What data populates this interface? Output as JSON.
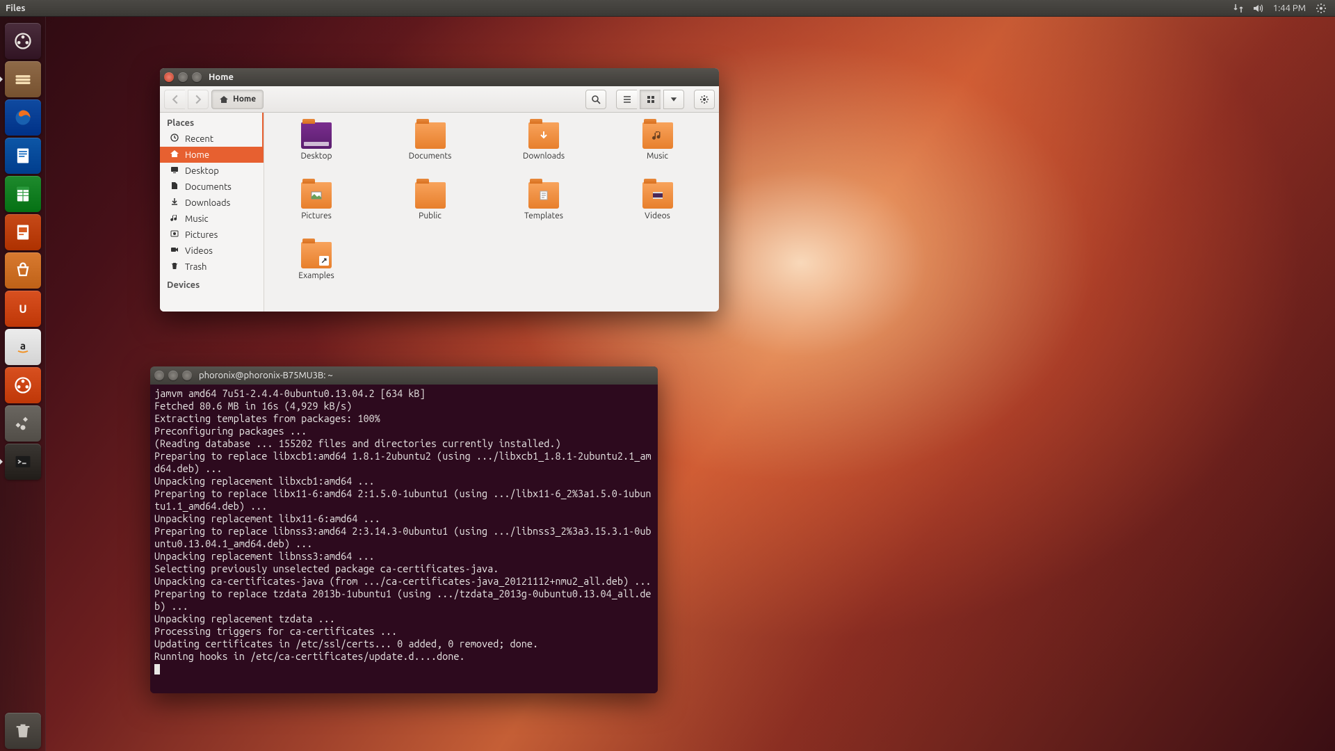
{
  "panel": {
    "app_title": "Files",
    "clock": "1:44 PM"
  },
  "launcher": {
    "items": [
      {
        "id": "dash",
        "name": "dash-icon",
        "color": "#4a2d3c"
      },
      {
        "id": "files",
        "name": "files-icon",
        "color": "#8f6a48",
        "running": true
      },
      {
        "id": "firefox",
        "name": "firefox-icon",
        "color": "#0f4aa0"
      },
      {
        "id": "writer",
        "name": "libreoffice-writer-icon",
        "color": "#0d56a6"
      },
      {
        "id": "calc",
        "name": "libreoffice-calc-icon",
        "color": "#1e8a2d"
      },
      {
        "id": "impress",
        "name": "libreoffice-impress-icon",
        "color": "#c74a19"
      },
      {
        "id": "software",
        "name": "software-center-icon",
        "color": "#d87a30"
      },
      {
        "id": "ubuntu-one",
        "name": "ubuntu-one-icon",
        "color": "#d85020"
      },
      {
        "id": "amazon",
        "name": "amazon-icon",
        "color": "#ececec"
      },
      {
        "id": "updater",
        "name": "software-updater-icon",
        "color": "#d85020"
      },
      {
        "id": "settings",
        "name": "system-settings-icon",
        "color": "#6a6660"
      },
      {
        "id": "terminal",
        "name": "terminal-icon",
        "color": "#3a3632",
        "running": true
      }
    ],
    "trash_name": "trash-icon"
  },
  "files_window": {
    "title": "Home",
    "path_label": "Home",
    "sidebar": {
      "places_label": "Places",
      "items": [
        {
          "label": "Recent",
          "icon": "clock"
        },
        {
          "label": "Home",
          "icon": "home",
          "active": true
        },
        {
          "label": "Desktop",
          "icon": "desktop"
        },
        {
          "label": "Documents",
          "icon": "documents"
        },
        {
          "label": "Downloads",
          "icon": "downloads"
        },
        {
          "label": "Music",
          "icon": "music"
        },
        {
          "label": "Pictures",
          "icon": "pictures"
        },
        {
          "label": "Videos",
          "icon": "videos"
        },
        {
          "label": "Trash",
          "icon": "trash"
        }
      ],
      "devices_label": "Devices"
    },
    "folders": [
      {
        "label": "Desktop",
        "kind": "desktop"
      },
      {
        "label": "Documents",
        "kind": "folder"
      },
      {
        "label": "Downloads",
        "kind": "downloads"
      },
      {
        "label": "Music",
        "kind": "music"
      },
      {
        "label": "Pictures",
        "kind": "pictures"
      },
      {
        "label": "Public",
        "kind": "folder"
      },
      {
        "label": "Templates",
        "kind": "templates"
      },
      {
        "label": "Videos",
        "kind": "videos"
      },
      {
        "label": "Examples",
        "kind": "link"
      }
    ]
  },
  "terminal": {
    "title": "phoronix@phoronix-B75MU3B: ~",
    "lines": [
      "jamvm amd64 7u51-2.4.4-0ubuntu0.13.04.2 [634 kB]",
      "Fetched 80.6 MB in 16s (4,929 kB/s)",
      "Extracting templates from packages: 100%",
      "Preconfiguring packages ...",
      "(Reading database ... 155202 files and directories currently installed.)",
      "Preparing to replace libxcb1:amd64 1.8.1-2ubuntu2 (using .../libxcb1_1.8.1-2ubuntu2.1_amd64.deb) ...",
      "Unpacking replacement libxcb1:amd64 ...",
      "Preparing to replace libx11-6:amd64 2:1.5.0-1ubuntu1 (using .../libx11-6_2%3a1.5.0-1ubuntu1.1_amd64.deb) ...",
      "Unpacking replacement libx11-6:amd64 ...",
      "Preparing to replace libnss3:amd64 2:3.14.3-0ubuntu1 (using .../libnss3_2%3a3.15.3.1-0ubuntu0.13.04.1_amd64.deb) ...",
      "Unpacking replacement libnss3:amd64 ...",
      "Selecting previously unselected package ca-certificates-java.",
      "Unpacking ca-certificates-java (from .../ca-certificates-java_20121112+nmu2_all.deb) ...",
      "Preparing to replace tzdata 2013b-1ubuntu1 (using .../tzdata_2013g-0ubuntu0.13.04_all.deb) ...",
      "Unpacking replacement tzdata ...",
      "Processing triggers for ca-certificates ...",
      "Updating certificates in /etc/ssl/certs... 0 added, 0 removed; done.",
      "Running hooks in /etc/ca-certificates/update.d....done."
    ]
  }
}
